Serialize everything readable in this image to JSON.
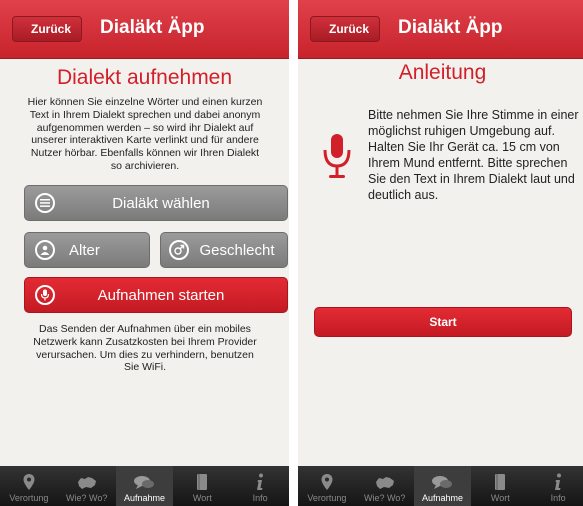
{
  "left": {
    "back_label": "Zurück",
    "nav_title": "Dialäkt Äpp",
    "heading": "Dialekt aufnehmen",
    "intro": "Hier können Sie einzelne Wörter und einen kurzen Text in Ihrem Dialekt sprechen und dabei anonym aufgenommen werden – so wird ihr Dialekt auf unserer interaktiven Karte verlinkt und für andere Nutzer hörbar. Ebenfalls können wir Ihren Dialekt so archivieren.",
    "dialect_button": "Dialäkt wählen",
    "age_button": "Alter",
    "gender_button": "Geschlecht",
    "record_button": "Aufnahmen starten",
    "note": "Das Senden der Aufnahmen über ein mobiles Netzwerk kann Zusatzkosten bei Ihrem Provider verursachen. Um dies zu verhindern, benutzen Sie WiFi."
  },
  "right": {
    "back_label": "Zurück",
    "nav_title": "Dialäkt Äpp",
    "heading": "Anleitung",
    "instructions": "Bitte nehmen Sie Ihre Stimme in einer möglichst ruhigen Umgebung auf. Halten Sie Ihr Gerät ca. 15 cm von Ihrem Mund entfernt. Bitte sprechen Sie den Text in Ihrem Dialekt laut und deutlich aus.",
    "start_button": "Start"
  },
  "tabbar": {
    "tabs": [
      "Verortung",
      "Wie? Wo?",
      "Aufnahme",
      "Wort",
      "Info"
    ],
    "active": "Aufnahme",
    "icons": [
      "pin-icon",
      "switzerland-icon",
      "speech-bubbles-icon",
      "book-icon",
      "info-icon"
    ]
  },
  "colors": {
    "brand_red": "#d1202a",
    "button_grey": "#8a8a8a",
    "background": "#f3f1ee",
    "tabbar": "#1e1e1e"
  }
}
